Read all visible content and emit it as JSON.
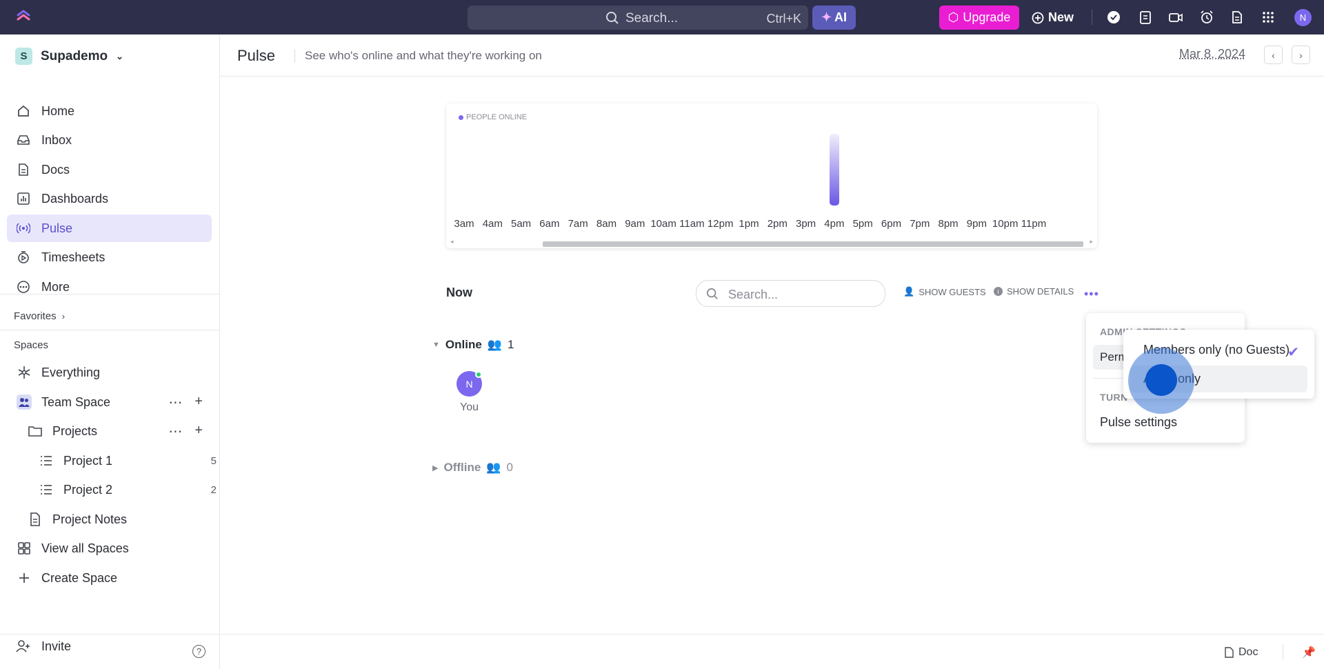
{
  "topbar": {
    "search_placeholder": "Search...",
    "search_shortcut": "Ctrl+K",
    "ai_label": "AI",
    "upgrade_label": "Upgrade",
    "new_label": "New",
    "user_initial": "N"
  },
  "sidebar": {
    "workspace_initial": "S",
    "workspace_name": "Supademo",
    "nav": [
      {
        "label": "Home",
        "icon": "home-icon"
      },
      {
        "label": "Inbox",
        "icon": "inbox-icon"
      },
      {
        "label": "Docs",
        "icon": "docs-icon"
      },
      {
        "label": "Dashboards",
        "icon": "dashboards-icon"
      },
      {
        "label": "Pulse",
        "icon": "pulse-icon",
        "active": true
      },
      {
        "label": "Timesheets",
        "icon": "timesheets-icon"
      },
      {
        "label": "More",
        "icon": "more-icon"
      }
    ],
    "favorites_label": "Favorites",
    "spaces_label": "Spaces",
    "spaces": {
      "everything": "Everything",
      "team_space": "Team Space",
      "projects": "Projects",
      "project1": "Project 1",
      "project1_count": "5",
      "project2": "Project 2",
      "project2_count": "2",
      "project_notes": "Project Notes",
      "view_all": "View all Spaces",
      "create": "Create Space"
    },
    "invite_label": "Invite"
  },
  "header": {
    "title": "Pulse",
    "subtitle": "See who's online and what they're working on",
    "date": "Mar 8, 2024"
  },
  "chart_data": {
    "type": "bar",
    "title": "PEOPLE ONLINE",
    "categories": [
      "3am",
      "4am",
      "5am",
      "6am",
      "7am",
      "8am",
      "9am",
      "10am",
      "11am",
      "12pm",
      "1pm",
      "2pm",
      "3pm",
      "4pm",
      "5pm",
      "6pm",
      "7pm",
      "8pm",
      "9pm",
      "10pm",
      "11pm"
    ],
    "values": [
      0,
      0,
      0,
      0,
      0,
      0,
      0,
      0,
      0,
      0,
      0,
      0,
      0,
      1,
      0,
      0,
      0,
      0,
      0,
      0,
      0
    ],
    "ylim": [
      0,
      1
    ],
    "color": "#6a58e5"
  },
  "now": {
    "title": "Now",
    "search_placeholder": "Search...",
    "show_guests": "SHOW GUESTS",
    "show_details": "SHOW DETAILS",
    "online_label": "Online",
    "online_count": "1",
    "offline_label": "Offline",
    "offline_count": "0",
    "user_initial": "N",
    "user_label": "You"
  },
  "menu": {
    "admin_header": "ADMIN SETTINGS",
    "permissions_label": "Perm",
    "turn_header": "TURN",
    "pulse_settings": "Pulse settings"
  },
  "submenu": {
    "option1": "Members only (no Guests)",
    "option2_prefix": "A",
    "option2_suffix": "only"
  },
  "footer": {
    "doc_label": "Doc"
  }
}
